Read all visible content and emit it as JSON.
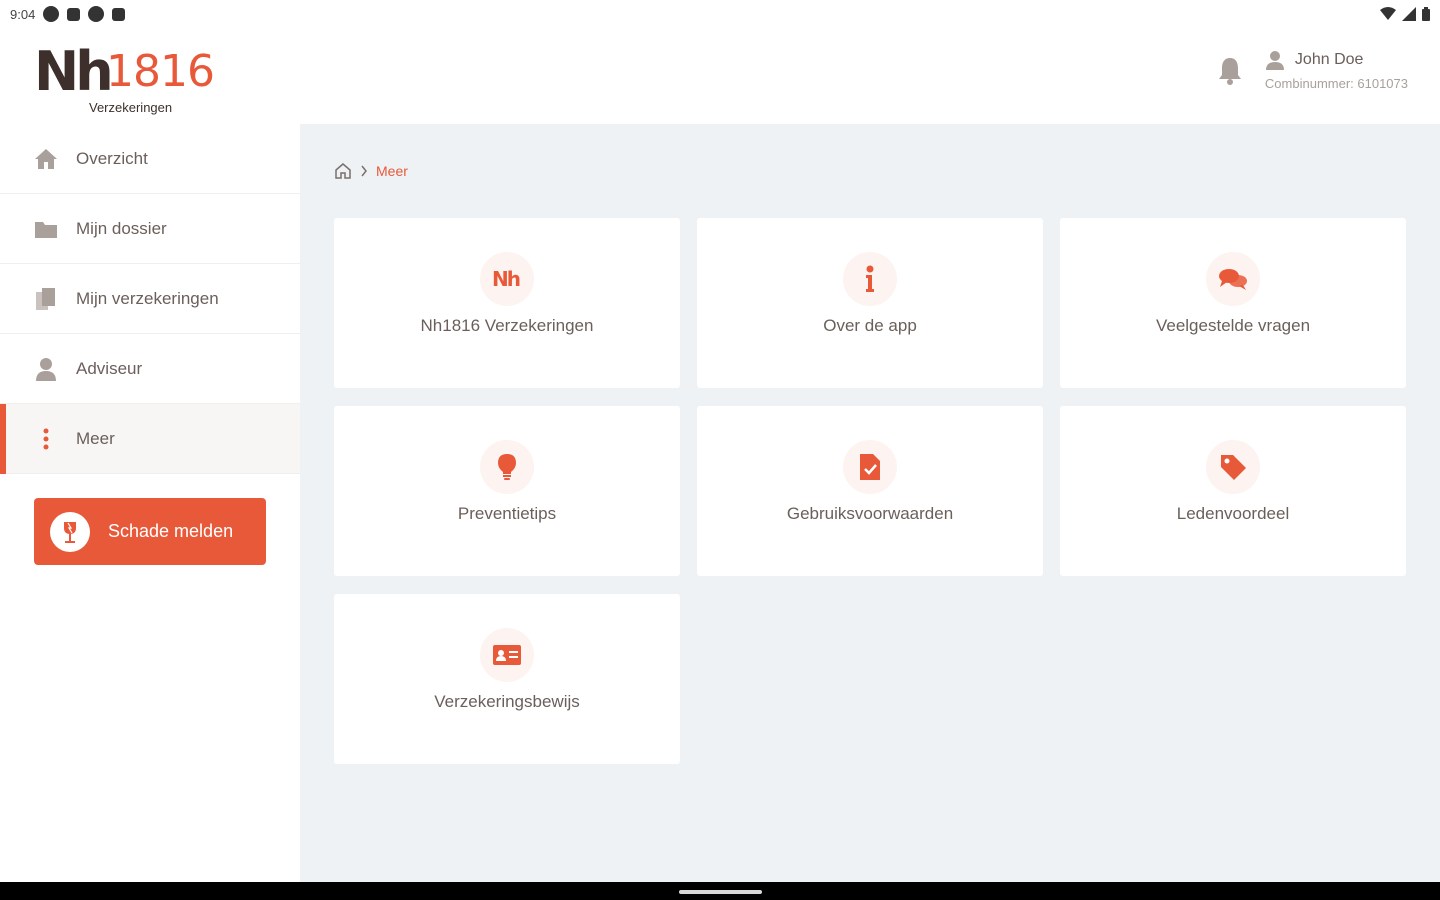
{
  "status_bar": {
    "time": "9:04"
  },
  "header": {
    "logo_main": "Nh",
    "logo_number": "1816",
    "logo_sub": "Verzekeringen",
    "user_name": "John Doe",
    "user_sub": "Combinummer: 6101073"
  },
  "sidebar": {
    "items": [
      {
        "label": "Overzicht",
        "icon": "home-icon"
      },
      {
        "label": "Mijn dossier",
        "icon": "folder-icon"
      },
      {
        "label": "Mijn verzekeringen",
        "icon": "documents-icon"
      },
      {
        "label": "Adviseur",
        "icon": "user-icon"
      },
      {
        "label": "Meer",
        "icon": "more-vertical-icon",
        "active": true
      }
    ],
    "cta_label": "Schade melden"
  },
  "breadcrumb": {
    "current": "Meer"
  },
  "tiles": [
    {
      "label": "Nh1816 Verzekeringen",
      "icon": "nh-logo-icon"
    },
    {
      "label": "Over de app",
      "icon": "info-icon"
    },
    {
      "label": "Veelgestelde vragen",
      "icon": "chat-icon"
    },
    {
      "label": "Preventietips",
      "icon": "lightbulb-icon"
    },
    {
      "label": "Gebruiksvoorwaarden",
      "icon": "document-check-icon"
    },
    {
      "label": "Ledenvoordeel",
      "icon": "tag-icon"
    },
    {
      "label": "Verzekeringsbewijs",
      "icon": "id-card-icon"
    }
  ],
  "colors": {
    "accent": "#e8593a",
    "brand_dark": "#3d302c",
    "background": "#eef2f5"
  }
}
